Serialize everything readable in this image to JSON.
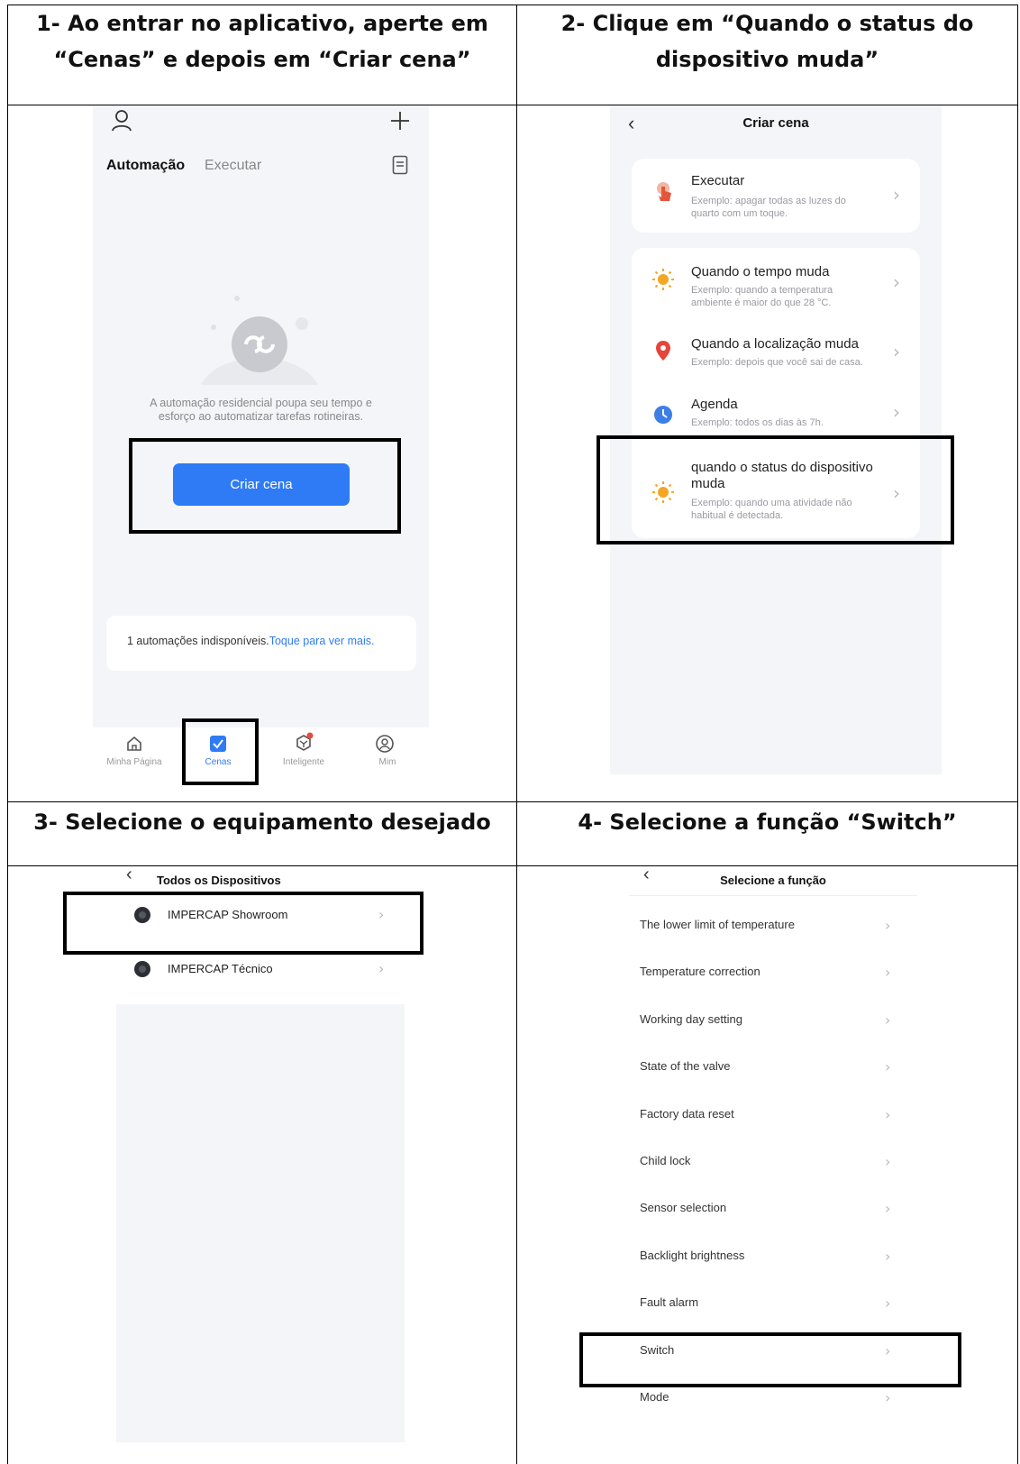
{
  "steps": [
    {
      "title_line1": "1- Ao entrar no aplicativo, aperte em",
      "title_line2": "“Cenas” e depois em “Criar cena”"
    },
    {
      "title_line1": "2- Clique em “Quando o status do",
      "title_line2": "dispositivo muda”"
    },
    {
      "title": "3- Selecione o equipamento desejado"
    },
    {
      "title": "4- Selecione a função “Switch”"
    }
  ],
  "screen1": {
    "tabs": {
      "active": "Automação",
      "inactive": "Executar"
    },
    "empty_text_line1": "A automação residencial poupa seu tempo e",
    "empty_text_line2": "esforço ao automatizar tarefas rotineiras.",
    "create_button": "Criar cena",
    "unavailable_text": "1 automações indisponíveis.",
    "unavailable_link": "Toque para ver mais.",
    "nav": [
      "Minha Página",
      "Cenas",
      "Inteligente",
      "Mim"
    ],
    "colors": {
      "accent": "#2f7bf5",
      "background": "#f4f5f9"
    }
  },
  "screen2": {
    "title": "Criar cena",
    "options": [
      {
        "title": "Executar",
        "sub1": "Exemplo: apagar todas as luzes do",
        "sub2": "quarto com um toque.",
        "icon": "touch-icon"
      },
      {
        "title": "Quando o tempo muda",
        "sub1": "Exemplo: quando a temperatura",
        "sub2": "ambiente é maior do que 28 °C.",
        "icon": "sun-icon"
      },
      {
        "title": "Quando a localização muda",
        "sub1": "Exemplo: depois que você sai de casa.",
        "sub2": "",
        "icon": "location-pin-icon"
      },
      {
        "title": "Agenda",
        "sub1": "Exemplo: todos os dias às 7h.",
        "sub2": "",
        "icon": "clock-icon"
      },
      {
        "title1": "quando o status do dispositivo",
        "title2": "muda",
        "sub1": "Exemplo: quando uma atividade não",
        "sub2": "habitual é detectada.",
        "icon": "sun-icon"
      }
    ]
  },
  "screen3": {
    "title": "Todos os Dispositivos",
    "devices": [
      "IMPERCAP Showroom",
      "IMPERCAP Técnico"
    ]
  },
  "screen4": {
    "title": "Selecione a função",
    "functions": [
      "The lower limit of temperature",
      "Temperature correction",
      "Working day setting",
      "State of the valve",
      "Factory data reset",
      "Child lock",
      "Sensor selection",
      "Backlight brightness",
      "Fault alarm",
      "Switch",
      "Mode"
    ]
  }
}
